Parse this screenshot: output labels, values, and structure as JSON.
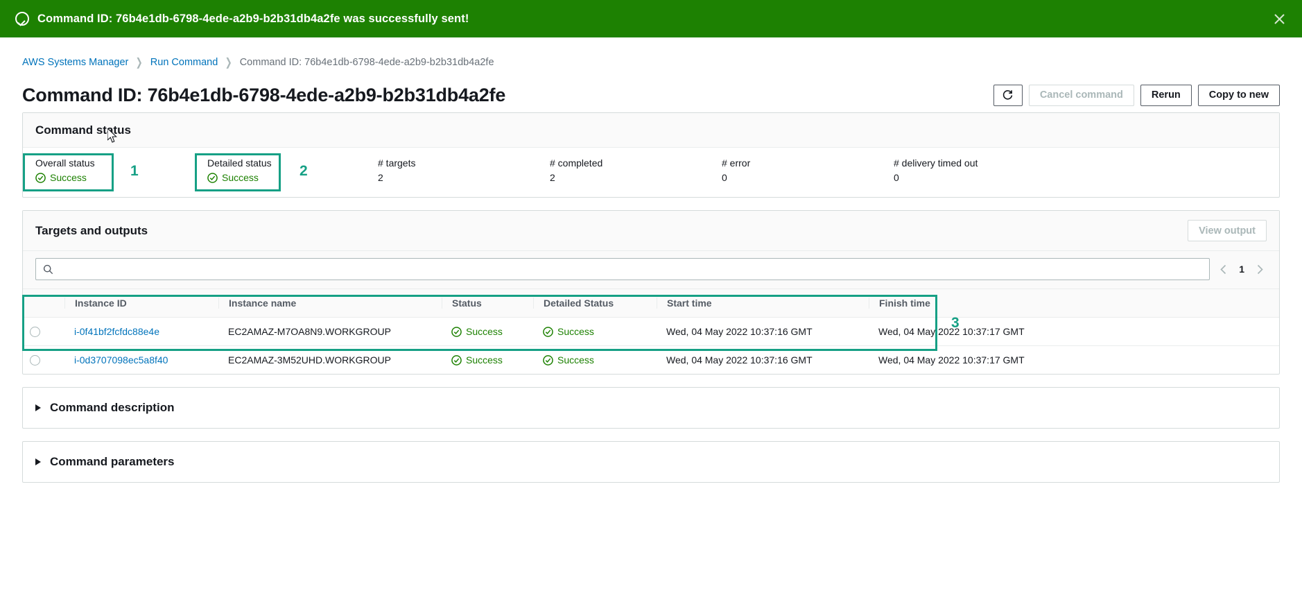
{
  "banner": {
    "message": "Command ID: 76b4e1db-6798-4ede-a2b9-b2b31db4a2fe was successfully sent!",
    "icon": "check-circle-icon",
    "close_icon": "close-icon",
    "background": "#1d8102"
  },
  "breadcrumb": {
    "items": [
      {
        "label": "AWS Systems Manager",
        "type": "link"
      },
      {
        "label": "Run Command",
        "type": "link"
      },
      {
        "label": "Command ID: 76b4e1db-6798-4ede-a2b9-b2b31db4a2fe",
        "type": "current"
      }
    ]
  },
  "header": {
    "title": "Command ID: 76b4e1db-6798-4ede-a2b9-b2b31db4a2fe",
    "refresh_icon": "refresh-icon",
    "cancel_label": "Cancel command",
    "rerun_label": "Rerun",
    "copy_label": "Copy to new"
  },
  "command_status": {
    "title": "Command status",
    "overall": {
      "label": "Overall status",
      "value": "Success",
      "icon": "success-check-icon"
    },
    "detailed": {
      "label": "Detailed status",
      "value": "Success",
      "icon": "success-check-icon"
    },
    "targets": {
      "label": "# targets",
      "value": "2"
    },
    "completed": {
      "label": "# completed",
      "value": "2"
    },
    "error": {
      "label": "# error",
      "value": "0"
    },
    "timed_out": {
      "label": "# delivery timed out",
      "value": "0"
    }
  },
  "annotations": {
    "one": "1",
    "two": "2",
    "three": "3",
    "color": "#16a085"
  },
  "targets": {
    "title": "Targets and outputs",
    "view_output_label": "View output",
    "search": {
      "placeholder": "",
      "value": "",
      "icon": "search-icon"
    },
    "pagination": {
      "prev_icon": "chevron-left-icon",
      "page": "1",
      "next_icon": "chevron-right-icon"
    },
    "columns": [
      "Instance ID",
      "Instance name",
      "Status",
      "Detailed Status",
      "Start time",
      "Finish time"
    ],
    "rows": [
      {
        "instance_id": "i-0f41bf2fcfdc88e4e",
        "instance_name": "EC2AMAZ-M7OA8N9.WORKGROUP",
        "status": "Success",
        "detailed_status": "Success",
        "start_time": "Wed, 04 May 2022 10:37:16 GMT",
        "finish_time": "Wed, 04 May 2022 10:37:17 GMT"
      },
      {
        "instance_id": "i-0d3707098ec5a8f40",
        "instance_name": "EC2AMAZ-3M52UHD.WORKGROUP",
        "status": "Success",
        "detailed_status": "Success",
        "start_time": "Wed, 04 May 2022 10:37:16 GMT",
        "finish_time": "Wed, 04 May 2022 10:37:17 GMT"
      }
    ]
  },
  "sections": {
    "description_title": "Command description",
    "parameters_title": "Command parameters"
  }
}
